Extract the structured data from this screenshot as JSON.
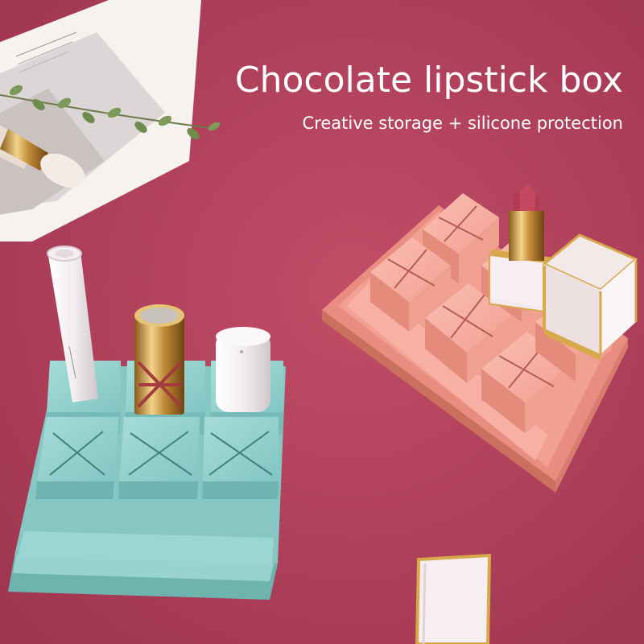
{
  "headline": {
    "title": "Chocolate lipstick box",
    "subtitle": "Creative storage + silicone protection"
  },
  "colors": {
    "background": "#b4415c",
    "pink_holder": "#f4a598",
    "teal_holder": "#8fcfcc",
    "text": "#ffffff",
    "gold_trim": "#d8a94a"
  },
  "icons": {
    "leaf_sprig": "leaf-sprig-icon",
    "cross_slot": "x-slot-icon"
  }
}
